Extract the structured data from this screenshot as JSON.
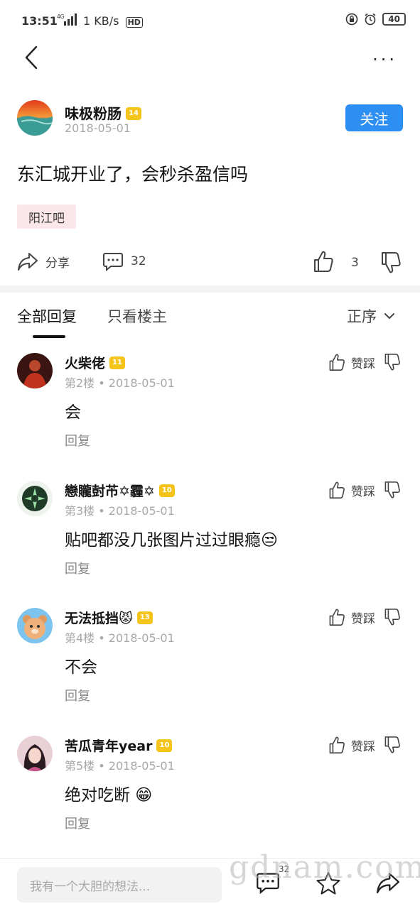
{
  "status_bar": {
    "time": "13:51",
    "signal": "4G",
    "network_speed": "1 KB/s",
    "hd": "HD",
    "battery": "40"
  },
  "nav": {
    "back_icon": "chevron-left-icon",
    "more_icon": "more-horizontal-icon",
    "more_label": "···"
  },
  "post": {
    "author": "味极粉肠",
    "author_level": "14",
    "date": "2018-05-01",
    "follow_label": "关注",
    "title": "东汇城开业了，会秒杀盈信吗",
    "forum": "阳江吧",
    "share_label": "分享",
    "comment_count": "32",
    "like_count": "3"
  },
  "tabs": {
    "all": "全部回复",
    "op_only": "只看楼主",
    "sort": "正序"
  },
  "replies": [
    {
      "name": "火柴佬",
      "level": "11",
      "floor": "第2楼",
      "date": "2018-05-01",
      "text": "会",
      "reply_label": "回复",
      "like_label": "赞踩"
    },
    {
      "name": "戀贚尌芇✡霾✡",
      "level": "10",
      "floor": "第3楼",
      "date": "2018-05-01",
      "text": "贴吧都没几张图片过过眼瘾😒",
      "reply_label": "回复",
      "like_label": "赞踩"
    },
    {
      "name": "无法抵挡😾",
      "level": "13",
      "floor": "第4楼",
      "date": "2018-05-01",
      "text": "不会",
      "reply_label": "回复",
      "like_label": "赞踩"
    },
    {
      "name": "苦瓜青年year",
      "level": "10",
      "floor": "第5楼",
      "date": "2018-05-01",
      "text": "绝对吃断 😁",
      "reply_label": "回复",
      "like_label": "赞踩"
    }
  ],
  "bottom_bar": {
    "placeholder": "我有一个大胆的想法...",
    "comment_count": "32"
  },
  "watermark": "gdnam.com",
  "colors": {
    "accent": "#2e8ff2",
    "level_badge": "#f4c41a",
    "forum_tag_bg": "#fbe7ea",
    "meta_text": "#a8a8a8"
  }
}
